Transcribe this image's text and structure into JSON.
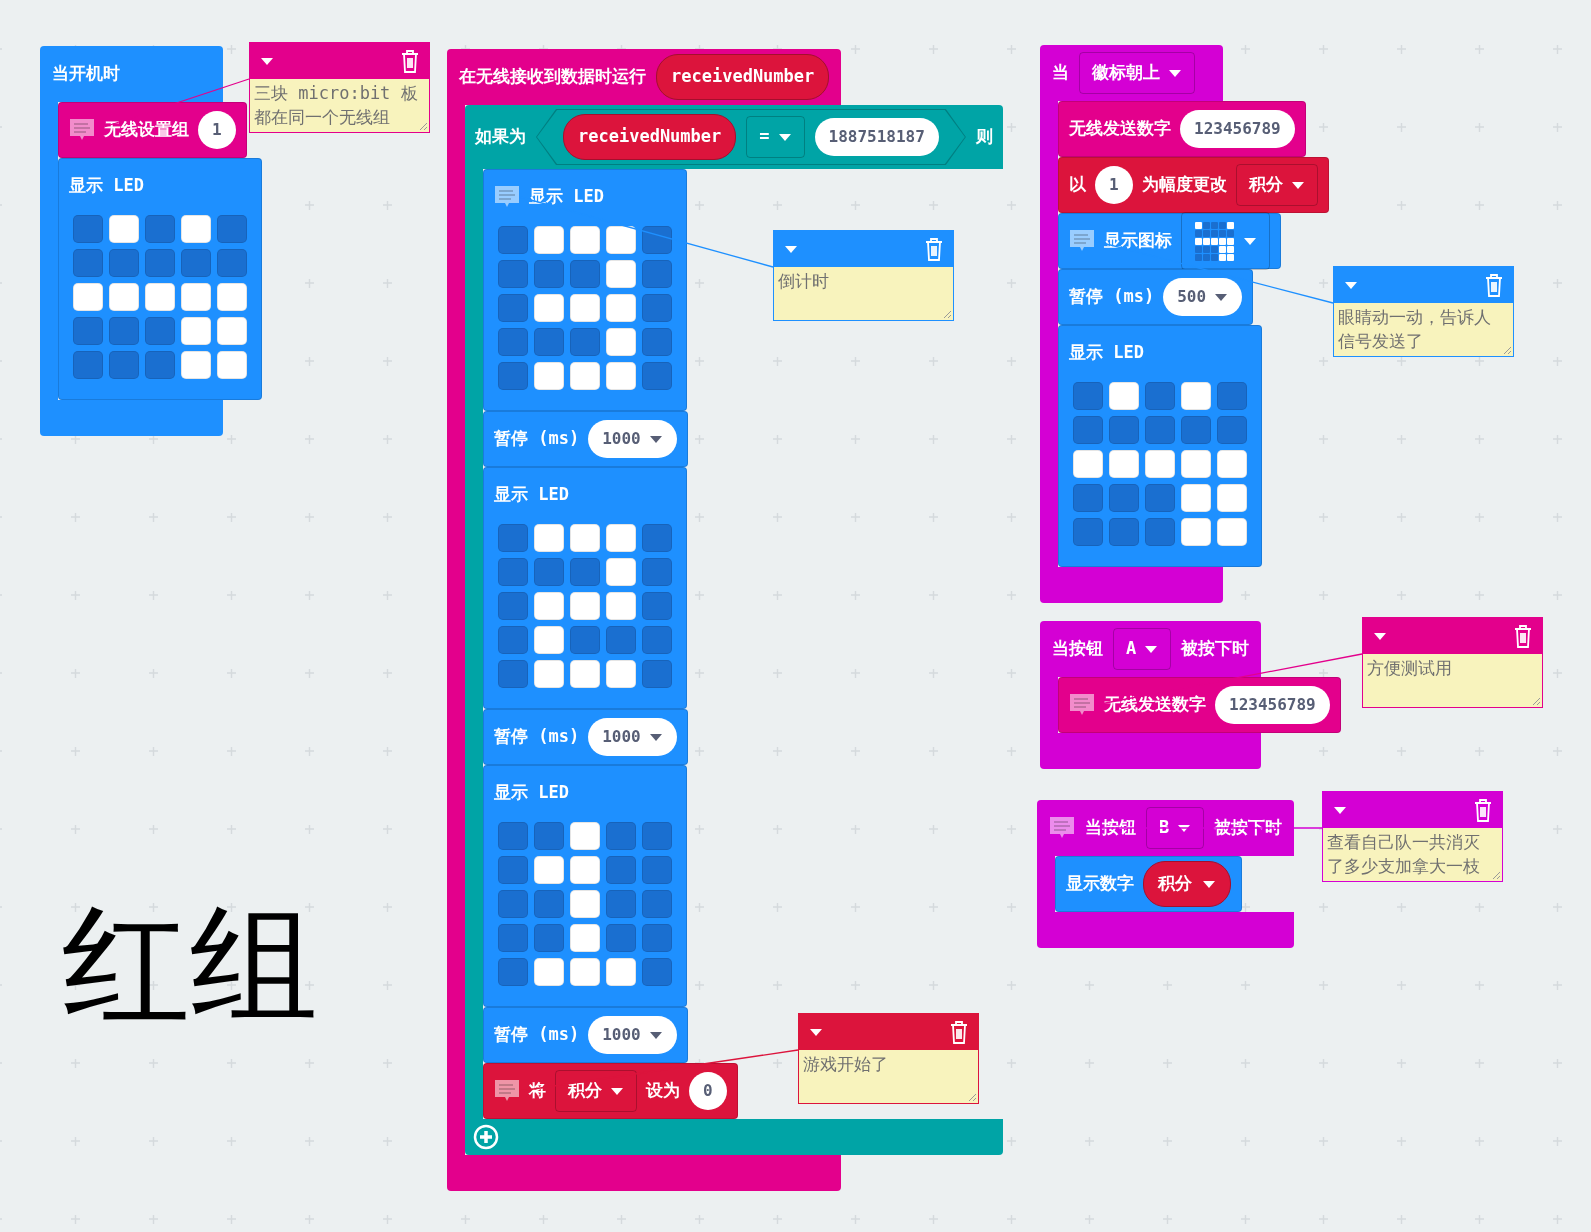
{
  "stacks": [
    {
      "color": "#1e90ff",
      "header": {
        "parts": [
          {
            "kind": "label",
            "text": "当开机时"
          }
        ]
      },
      "body": [
        {
          "kind": "statement",
          "color": "#e3008c",
          "parts": [
            {
              "kind": "label",
              "text": "无线设置组"
            },
            {
              "kind": "number",
              "text": "1"
            }
          ],
          "comment": {
            "lines": [
              "三块 micro:bit 板",
              "都在同一个无线组"
            ]
          }
        },
        {
          "kind": "led",
          "color": "#1e90ff",
          "parts": [
            {
              "kind": "label",
              "text": "显示 LED"
            }
          ],
          "leds": [
            [
              false,
              true,
              false,
              true,
              false
            ],
            [
              false,
              false,
              false,
              false,
              false
            ],
            [
              true,
              true,
              true,
              true,
              true
            ],
            [
              false,
              false,
              false,
              true,
              true
            ],
            [
              false,
              false,
              false,
              true,
              true
            ]
          ]
        }
      ]
    },
    {
      "color": "#e3008c",
      "header": {
        "parts": [
          {
            "kind": "label",
            "text": "在无线接收到数据时运行"
          },
          {
            "kind": "variable",
            "text": "receivedNumber"
          }
        ]
      },
      "body": [
        {
          "kind": "if",
          "color": "#00a4a6",
          "parts": [
            {
              "kind": "label",
              "text": "如果为"
            },
            {
              "kind": "condition",
              "parts": [
                {
                  "kind": "variable",
                  "text": "receivedNumber"
                },
                {
                  "kind": "dropdown",
                  "text": "="
                },
                {
                  "kind": "number",
                  "text": "1887518187"
                }
              ]
            },
            {
              "kind": "label",
              "text": "则"
            }
          ],
          "body": [
            {
              "kind": "led",
              "color": "#1e90ff",
              "parts": [
                {
                  "kind": "label",
                  "text": "显示 LED"
                }
              ],
              "comment": {
                "lines": [
                  "倒计时"
                ]
              },
              "leds": [
                [
                  false,
                  true,
                  true,
                  true,
                  false
                ],
                [
                  false,
                  false,
                  false,
                  true,
                  false
                ],
                [
                  false,
                  true,
                  true,
                  true,
                  false
                ],
                [
                  false,
                  false,
                  false,
                  true,
                  false
                ],
                [
                  false,
                  true,
                  true,
                  true,
                  false
                ]
              ]
            },
            {
              "kind": "statement",
              "color": "#1e90ff",
              "parts": [
                {
                  "kind": "label",
                  "text": "暂停 (ms)"
                },
                {
                  "kind": "number_dropdown",
                  "text": "1000"
                }
              ]
            },
            {
              "kind": "led",
              "color": "#1e90ff",
              "parts": [
                {
                  "kind": "label",
                  "text": "显示 LED"
                }
              ],
              "leds": [
                [
                  false,
                  true,
                  true,
                  true,
                  false
                ],
                [
                  false,
                  false,
                  false,
                  true,
                  false
                ],
                [
                  false,
                  true,
                  true,
                  true,
                  false
                ],
                [
                  false,
                  true,
                  false,
                  false,
                  false
                ],
                [
                  false,
                  true,
                  true,
                  true,
                  false
                ]
              ]
            },
            {
              "kind": "statement",
              "color": "#1e90ff",
              "parts": [
                {
                  "kind": "label",
                  "text": "暂停 (ms)"
                },
                {
                  "kind": "number_dropdown",
                  "text": "1000"
                }
              ]
            },
            {
              "kind": "led",
              "color": "#1e90ff",
              "parts": [
                {
                  "kind": "label",
                  "text": "显示 LED"
                }
              ],
              "leds": [
                [
                  false,
                  false,
                  true,
                  false,
                  false
                ],
                [
                  false,
                  true,
                  true,
                  false,
                  false
                ],
                [
                  false,
                  false,
                  true,
                  false,
                  false
                ],
                [
                  false,
                  false,
                  true,
                  false,
                  false
                ],
                [
                  false,
                  true,
                  true,
                  true,
                  false
                ]
              ]
            },
            {
              "kind": "statement",
              "color": "#1e90ff",
              "parts": [
                {
                  "kind": "label",
                  "text": "暂停 (ms)"
                },
                {
                  "kind": "number_dropdown",
                  "text": "1000"
                }
              ]
            },
            {
              "kind": "statement",
              "color": "#dc143c",
              "parts": [
                {
                  "kind": "label",
                  "text": "将"
                },
                {
                  "kind": "dropdown",
                  "text": "积分"
                },
                {
                  "kind": "label",
                  "text": "设为"
                },
                {
                  "kind": "number",
                  "text": "0"
                }
              ],
              "comment": {
                "lines": [
                  "游戏开始了"
                ]
              }
            }
          ]
        }
      ]
    },
    {
      "color": "#d400d4",
      "header": {
        "parts": [
          {
            "kind": "label",
            "text": "当"
          },
          {
            "kind": "dropdown",
            "text": "徽标朝上"
          }
        ]
      },
      "body": [
        {
          "kind": "statement",
          "color": "#e3008c",
          "parts": [
            {
              "kind": "label",
              "text": "无线发送数字"
            },
            {
              "kind": "number",
              "text": "123456789"
            }
          ]
        },
        {
          "kind": "statement",
          "color": "#dc143c",
          "parts": [
            {
              "kind": "label",
              "text": "以"
            },
            {
              "kind": "number",
              "text": "1"
            },
            {
              "kind": "label",
              "text": "为幅度更改"
            },
            {
              "kind": "dropdown",
              "text": "积分"
            }
          ]
        },
        {
          "kind": "statement",
          "color": "#1e90ff",
          "parts": [
            {
              "kind": "label",
              "text": "显示图标"
            },
            {
              "kind": "icon_dropdown",
              "leds": [
                [
                  true,
                  false,
                  false,
                  false,
                  true
                ],
                [
                  false,
                  false,
                  false,
                  false,
                  false
                ],
                [
                  true,
                  true,
                  true,
                  true,
                  true
                ],
                [
                  false,
                  false,
                  false,
                  true,
                  true
                ],
                [
                  false,
                  false,
                  false,
                  true,
                  true
                ]
              ]
            }
          ],
          "comment": {
            "lines": [
              "眼睛动一动，告诉人",
              "信号发送了"
            ]
          }
        },
        {
          "kind": "statement",
          "color": "#1e90ff",
          "parts": [
            {
              "kind": "label",
              "text": "暂停 (ms)"
            },
            {
              "kind": "number_dropdown",
              "text": "500"
            }
          ]
        },
        {
          "kind": "led",
          "color": "#1e90ff",
          "parts": [
            {
              "kind": "label",
              "text": "显示 LED"
            }
          ],
          "leds": [
            [
              false,
              true,
              false,
              true,
              false
            ],
            [
              false,
              false,
              false,
              false,
              false
            ],
            [
              true,
              true,
              true,
              true,
              true
            ],
            [
              false,
              false,
              false,
              true,
              true
            ],
            [
              false,
              false,
              false,
              true,
              true
            ]
          ]
        }
      ]
    },
    {
      "color": "#d400d4",
      "header": {
        "parts": [
          {
            "kind": "label",
            "text": "当按钮"
          },
          {
            "kind": "dropdown",
            "text": "A"
          },
          {
            "kind": "label",
            "text": "被按下时"
          }
        ]
      },
      "body": [
        {
          "kind": "statement",
          "color": "#e3008c",
          "parts": [
            {
              "kind": "label",
              "text": "无线发送数字"
            },
            {
              "kind": "number",
              "text": "123456789"
            }
          ],
          "comment": {
            "lines": [
              "方便测试用"
            ]
          }
        }
      ]
    },
    {
      "color": "#d400d4",
      "header": {
        "parts": [
          {
            "kind": "label",
            "text": "当按钮"
          },
          {
            "kind": "dropdown",
            "text": "B"
          },
          {
            "kind": "label",
            "text": "被按下时"
          }
        ],
        "comment": {
          "lines": [
            "查看自己队一共消灭",
            "了多少支加拿大一枝"
          ]
        }
      },
      "body": [
        {
          "kind": "statement",
          "color": "#1e90ff",
          "parts": [
            {
              "kind": "label",
              "text": "显示数字"
            },
            {
              "kind": "variable",
              "text": "积分",
              "dropdown": true
            }
          ]
        }
      ]
    }
  ],
  "team_label": "红组"
}
